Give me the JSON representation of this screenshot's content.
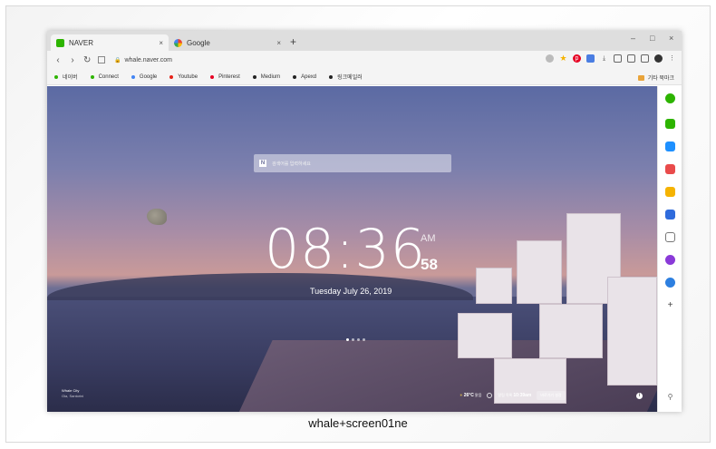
{
  "tabs": [
    {
      "label": "NAVER",
      "close": "×"
    },
    {
      "label": "Google",
      "close": "×"
    }
  ],
  "new_tab": "+",
  "window_controls": {
    "minimize": "–",
    "maximize": "□",
    "close": "×"
  },
  "toolbar": {
    "back": "‹",
    "forward": "›",
    "reload": "↻",
    "url": "whale.naver.com"
  },
  "bookmarks": [
    {
      "label": "네이버",
      "color": "#2db400"
    },
    {
      "label": "Connect",
      "color": "#2db400"
    },
    {
      "label": "Google",
      "color": "#4285f4"
    },
    {
      "label": "Youtube",
      "color": "#e62117"
    },
    {
      "label": "Pinterest",
      "color": "#e60023"
    },
    {
      "label": "Medium",
      "color": "#222222"
    },
    {
      "label": "Apexd",
      "color": "#222222"
    },
    {
      "label": "링크메일러",
      "color": "#222222"
    }
  ],
  "other_bookmarks": "기타 북마크",
  "newtab_page": {
    "search_placeholder": "검색어를 입력하세요",
    "time": "08:36",
    "ampm": "AM",
    "seconds": "58",
    "date": "Tuesday July 26, 2019",
    "credit_title": "Whale City",
    "credit_sub": "Oia, Santorini",
    "weather": "26°C",
    "weather_label": "맑음",
    "alarm_label": "알림 목록",
    "alarm_time": "10:39am",
    "shortcut_label": "바로가기 설정"
  },
  "caption": "whale+screen01ne",
  "icons": {
    "sidebar": [
      "whale-icon",
      "naver-talk-icon",
      "calendar-icon",
      "pocket-icon",
      "memo-icon",
      "translate-icon",
      "papago-icon",
      "music-icon",
      "cloud-icon",
      "add-icon",
      "pin-icon"
    ]
  }
}
